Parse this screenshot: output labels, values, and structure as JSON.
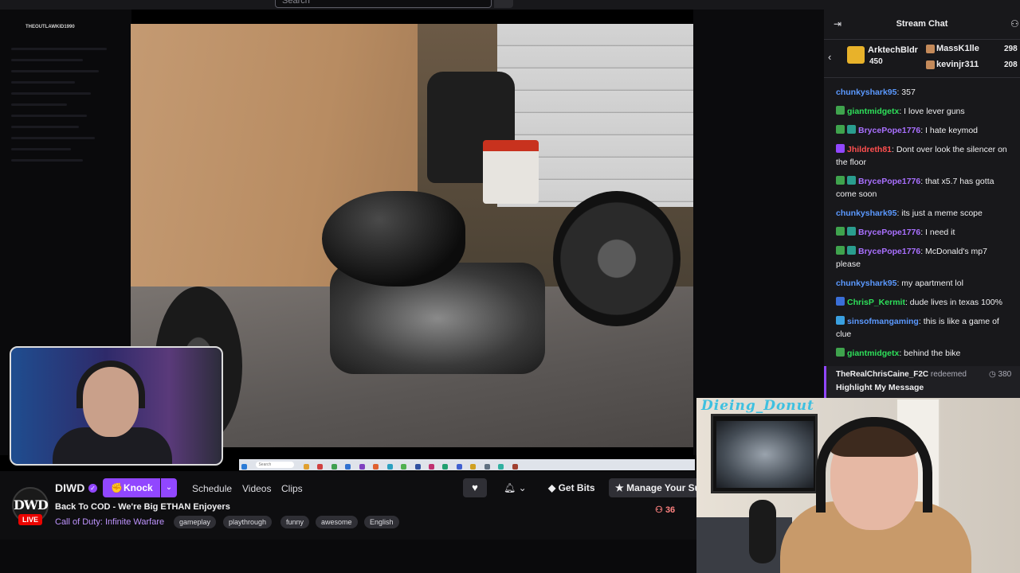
{
  "topbar": {
    "search_placeholder": "Search"
  },
  "desktop": {
    "title": "THEOUTLAWKID1990"
  },
  "taskbar": {
    "search_label": "Search"
  },
  "channel": {
    "avatar_text": "DWD",
    "live_label": "LIVE",
    "name": "DIWD",
    "verified_glyph": "✓",
    "knock_label": "Knock",
    "nav": {
      "schedule": "Schedule",
      "videos": "Videos",
      "clips": "Clips"
    },
    "stream_title": "Back To COD - We're Big ETHAN Enjoyers",
    "game": "Call of Duty: Infinite Warfare",
    "tags": [
      "gameplay",
      "playthrough",
      "funny",
      "awesome",
      "English"
    ],
    "get_bits_label": "Get Bits",
    "manage_sub_label": "Manage Your Su",
    "viewers": "36"
  },
  "chat": {
    "title": "Stream Chat",
    "leaderboard": {
      "top_name": "ArktechBldr",
      "top_count": "450",
      "second_name": "MassK1lle",
      "second_count": "298",
      "third_name": "kevinjr311",
      "third_count": "208"
    },
    "messages": [
      {
        "user": "chunkyshark95",
        "color": "#5b99ff",
        "badges": [],
        "text": ": 357"
      },
      {
        "user": "giantmidgetx",
        "color": "#2ee05a",
        "badges": [
          "#3fa34d"
        ],
        "text": ": I love lever guns"
      },
      {
        "user": "BrycePope1776",
        "color": "#a970ff",
        "badges": [
          "#3fa34d",
          "#2a9d8f"
        ],
        "text": ": I hate keymod"
      },
      {
        "user": "Jhildreth81",
        "color": "#ff4f4f",
        "badges": [
          "#9147ff"
        ],
        "text": ": Dont over look the silencer on the floor"
      },
      {
        "user": "BrycePope1776",
        "color": "#a970ff",
        "badges": [
          "#3fa34d",
          "#2a9d8f"
        ],
        "text": ": that x5.7 has gotta come soon"
      },
      {
        "user": "chunkyshark95",
        "color": "#5b99ff",
        "badges": [],
        "text": ": its just a meme scope"
      },
      {
        "user": "BrycePope1776",
        "color": "#a970ff",
        "badges": [
          "#3fa34d",
          "#2a9d8f"
        ],
        "text": ": I need it"
      },
      {
        "user": "BrycePope1776",
        "color": "#a970ff",
        "badges": [
          "#3fa34d",
          "#2a9d8f"
        ],
        "text": ": McDonald's mp7 please"
      },
      {
        "user": "chunkyshark95",
        "color": "#5b99ff",
        "badges": [],
        "text": ": my apartment lol"
      },
      {
        "user": "ChrisP_Kermit",
        "color": "#2ee05a",
        "badges": [
          "#3a6fd8"
        ],
        "text": ": dude lives in texas 100%"
      },
      {
        "user": "sinsofmangaming",
        "color": "#5b99ff",
        "badges": [
          "#3aa0e0"
        ],
        "text": ": this is like a game of clue"
      },
      {
        "user": "giantmidgetx",
        "color": "#2ee05a",
        "badges": [
          "#3fa34d"
        ],
        "text": ": behind the bike"
      }
    ],
    "redemption": {
      "user": "TheRealChrisCaine_F2C",
      "action": " redeemed",
      "reward": "Highlight My Message",
      "cost": "380"
    }
  },
  "guest_cam": {
    "label": "Dieing_Donut"
  }
}
